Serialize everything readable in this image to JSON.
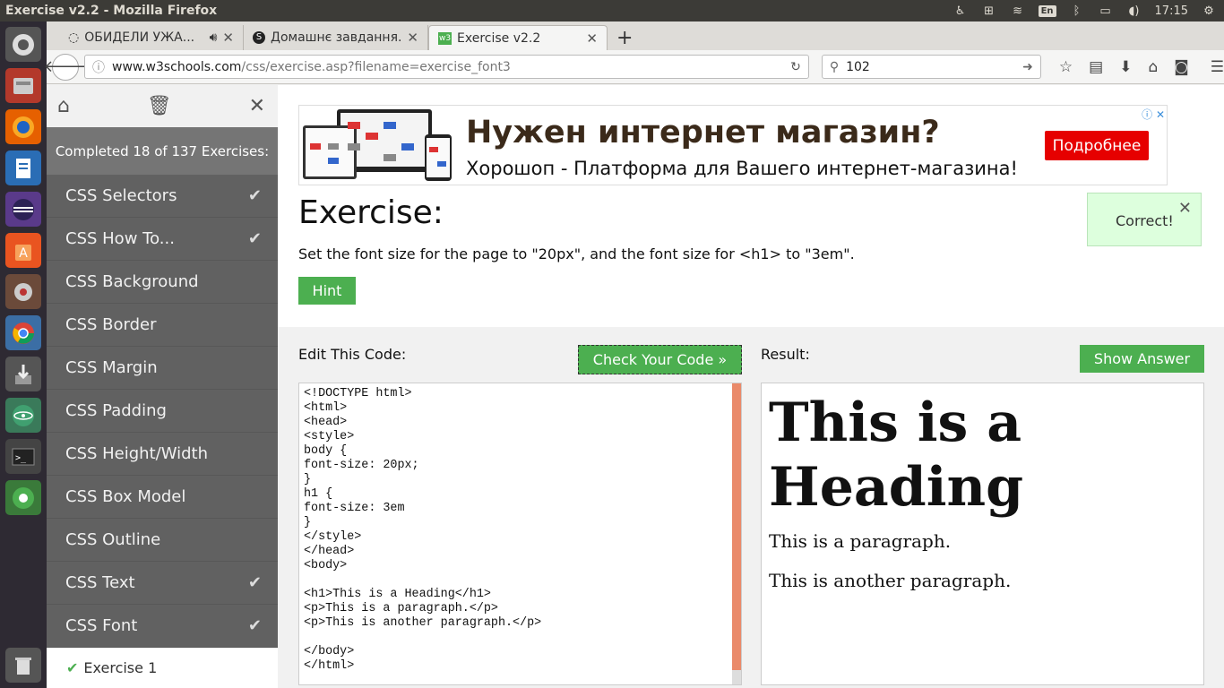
{
  "window": {
    "title": "Exercise v2.2 - Mozilla Firefox",
    "time": "17:15",
    "keyboard": "En"
  },
  "tabs": [
    {
      "label": "ОБИДЕЛИ УЖА...",
      "icon": "spinner-icon"
    },
    {
      "label": "Домашнє завдання...",
      "icon": "skype-icon"
    },
    {
      "label": "Exercise v2.2",
      "icon": "w3schools-icon"
    }
  ],
  "nav": {
    "url_domain": "www.w3schools.com",
    "url_path": "/css/exercise.asp?filename=exercise_font3",
    "search_value": "102"
  },
  "sidebar": {
    "progress": "Completed 18 of 137 Exercises:",
    "items": [
      {
        "label": "CSS Selectors",
        "done": "✔"
      },
      {
        "label": "CSS How To...",
        "done": "✔"
      },
      {
        "label": "CSS Background",
        "done": ""
      },
      {
        "label": "CSS Border",
        "done": ""
      },
      {
        "label": "CSS Margin",
        "done": ""
      },
      {
        "label": "CSS Padding",
        "done": ""
      },
      {
        "label": "CSS Height/Width",
        "done": ""
      },
      {
        "label": "CSS Box Model",
        "done": ""
      },
      {
        "label": "CSS Outline",
        "done": ""
      },
      {
        "label": "CSS Text",
        "done": "✔"
      },
      {
        "label": "CSS Font",
        "done": "✔"
      }
    ],
    "sub_item": {
      "check": "✔",
      "label": "Exercise 1"
    }
  },
  "ad": {
    "headline": "Нужен интернет магазин?",
    "subline": "Хорошоп - Платформа для Вашего интернет-магазина!",
    "button": "Подробнее"
  },
  "exercise": {
    "title": "Exercise:",
    "description": "Set the font size for the page to \"20px\", and the font size for <h1> to \"3em\".",
    "hint": "Hint",
    "status": "Correct!"
  },
  "editor": {
    "label": "Edit This Code:",
    "check_button": "Check Your Code »",
    "code": "<!DOCTYPE html>\n<html>\n<head>\n<style>\nbody {\nfont-size: 20px;\n}\nh1 {\nfont-size: 3em\n}\n</style>\n</head>\n<body>\n\n<h1>This is a Heading</h1>\n<p>This is a paragraph.</p>\n<p>This is another paragraph.</p>\n\n</body>\n</html>"
  },
  "result": {
    "label": "Result:",
    "answer_button": "Show Answer",
    "heading": "This is a Heading",
    "p1": "This is a paragraph.",
    "p2": "This is another paragraph."
  }
}
